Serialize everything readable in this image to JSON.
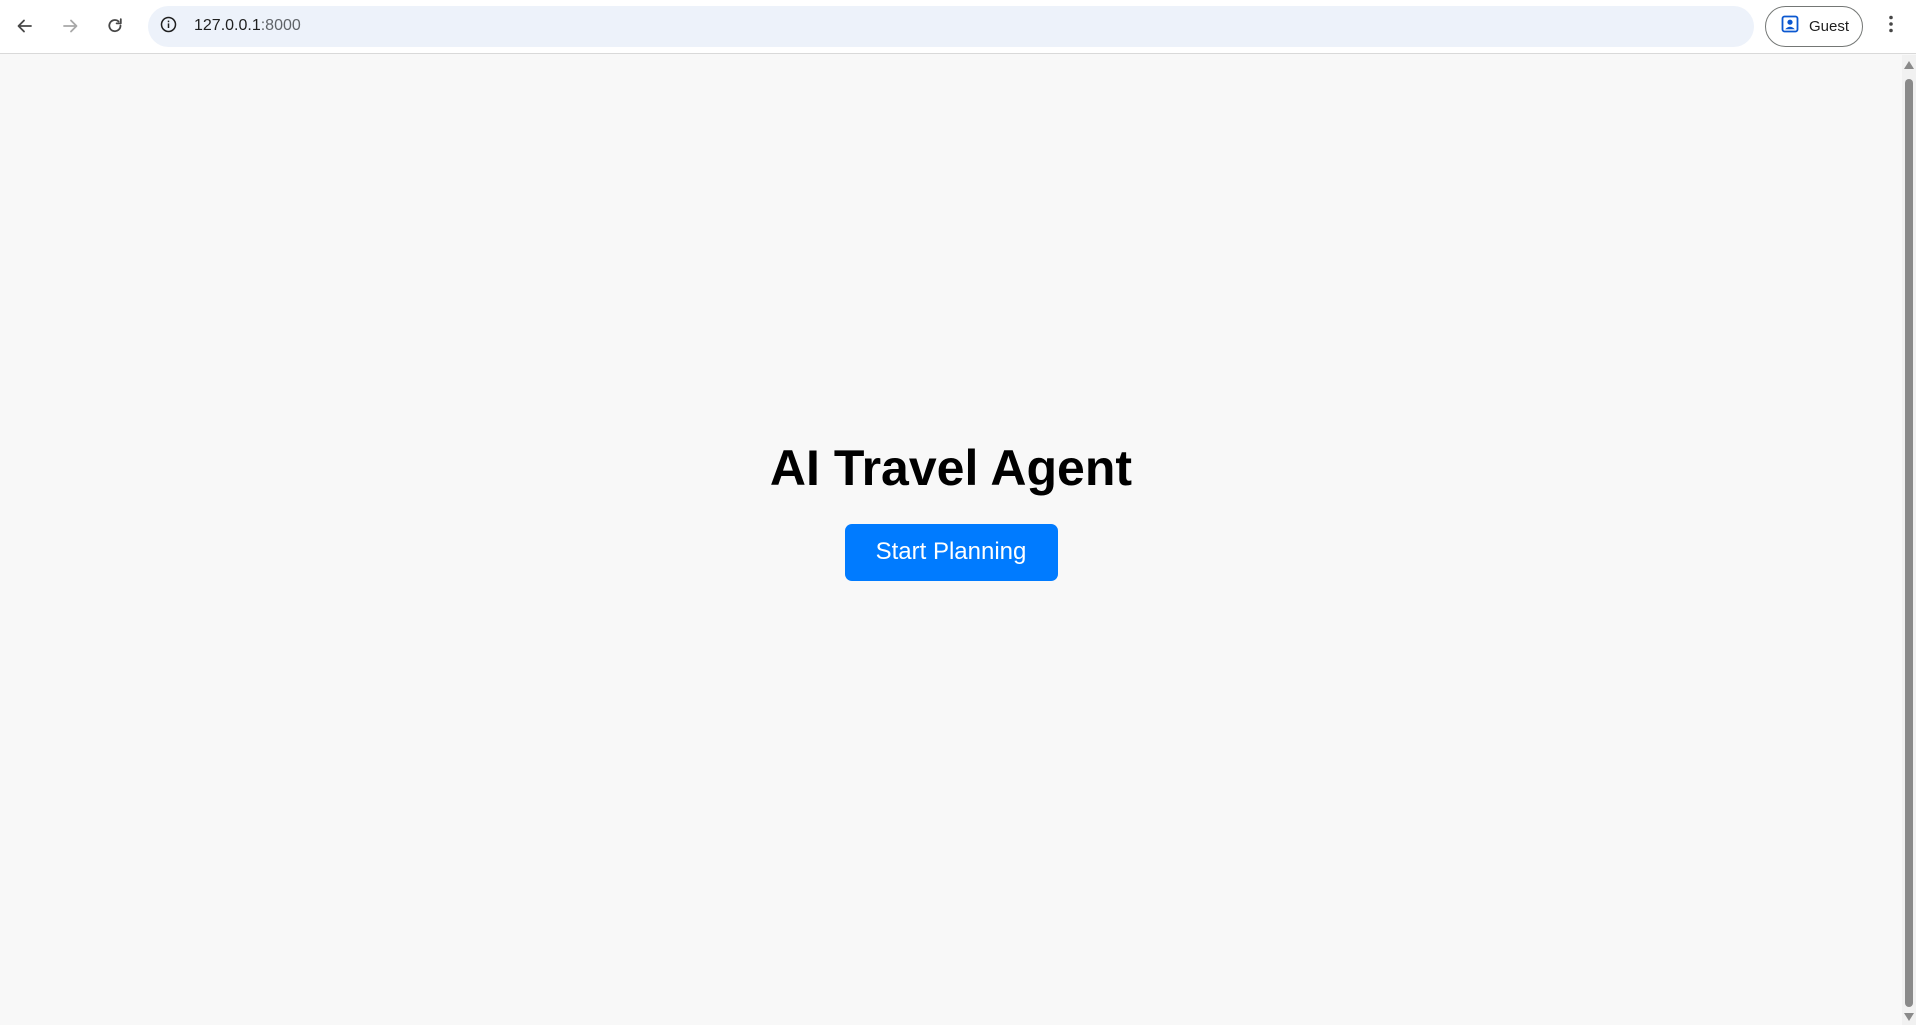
{
  "browser": {
    "url_host": "127.0.0.1",
    "url_port": ":8000",
    "profile_label": "Guest",
    "icons": {
      "back": "arrow-left-icon",
      "forward": "arrow-right-icon",
      "reload": "reload-icon",
      "site_info": "info-icon",
      "profile": "person-badge-icon",
      "menu": "kebab-menu-icon"
    }
  },
  "page": {
    "title": "AI Travel Agent",
    "cta_label": "Start Planning"
  },
  "colors": {
    "page_background": "#f8f8f8",
    "cta_background": "#007bff",
    "cta_text": "#ffffff",
    "title_text": "#000000",
    "omnibox_background": "#edf2fa"
  }
}
